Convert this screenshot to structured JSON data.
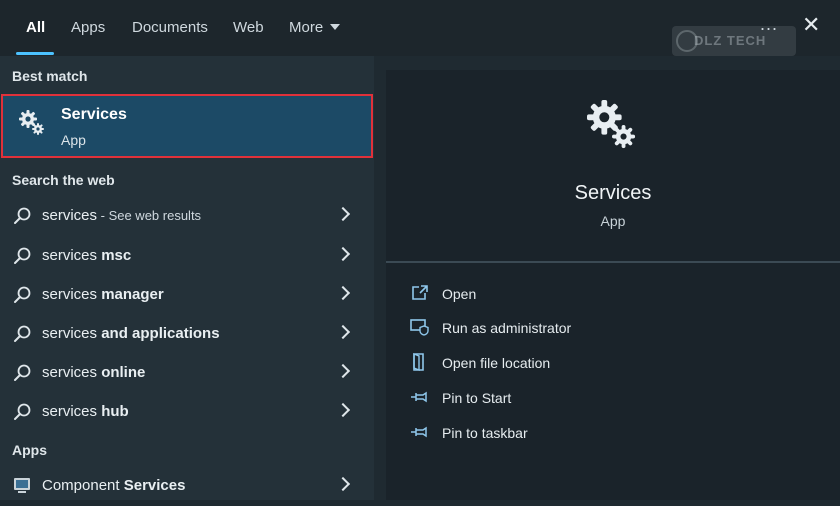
{
  "tabs": [
    {
      "label": "All"
    },
    {
      "label": "Apps"
    },
    {
      "label": "Documents"
    },
    {
      "label": "Web"
    },
    {
      "label": "More"
    }
  ],
  "header": {
    "more_options": "...",
    "close": "✕",
    "watermark": "DLZ TECH"
  },
  "best_match": {
    "heading": "Best match",
    "title": "Services",
    "subtitle": "App",
    "icon": "gears-icon"
  },
  "web_search": {
    "heading": "Search the web",
    "items": [
      {
        "prefix": "services",
        "bold": "",
        "suffix": " - See web results"
      },
      {
        "prefix": "services ",
        "bold": "msc",
        "suffix": ""
      },
      {
        "prefix": "services ",
        "bold": "manager",
        "suffix": ""
      },
      {
        "prefix": "services ",
        "bold": "and applications",
        "suffix": ""
      },
      {
        "prefix": "services ",
        "bold": "online",
        "suffix": ""
      },
      {
        "prefix": "services ",
        "bold": "hub",
        "suffix": ""
      }
    ]
  },
  "apps": {
    "heading": "Apps",
    "items": [
      {
        "prefix": "Component ",
        "bold": "Services"
      }
    ]
  },
  "detail": {
    "title": "Services",
    "subtitle": "App",
    "actions": [
      {
        "label": "Open",
        "icon": "open-icon"
      },
      {
        "label": "Run as administrator",
        "icon": "shield-admin-icon"
      },
      {
        "label": "Open file location",
        "icon": "file-location-icon"
      },
      {
        "label": "Pin to Start",
        "icon": "pin-icon"
      },
      {
        "label": "Pin to taskbar",
        "icon": "pin-icon"
      }
    ]
  },
  "colors": {
    "accent": "#4cc2ff",
    "selection": "#1c4a66",
    "highlight_border": "#e0313a"
  }
}
